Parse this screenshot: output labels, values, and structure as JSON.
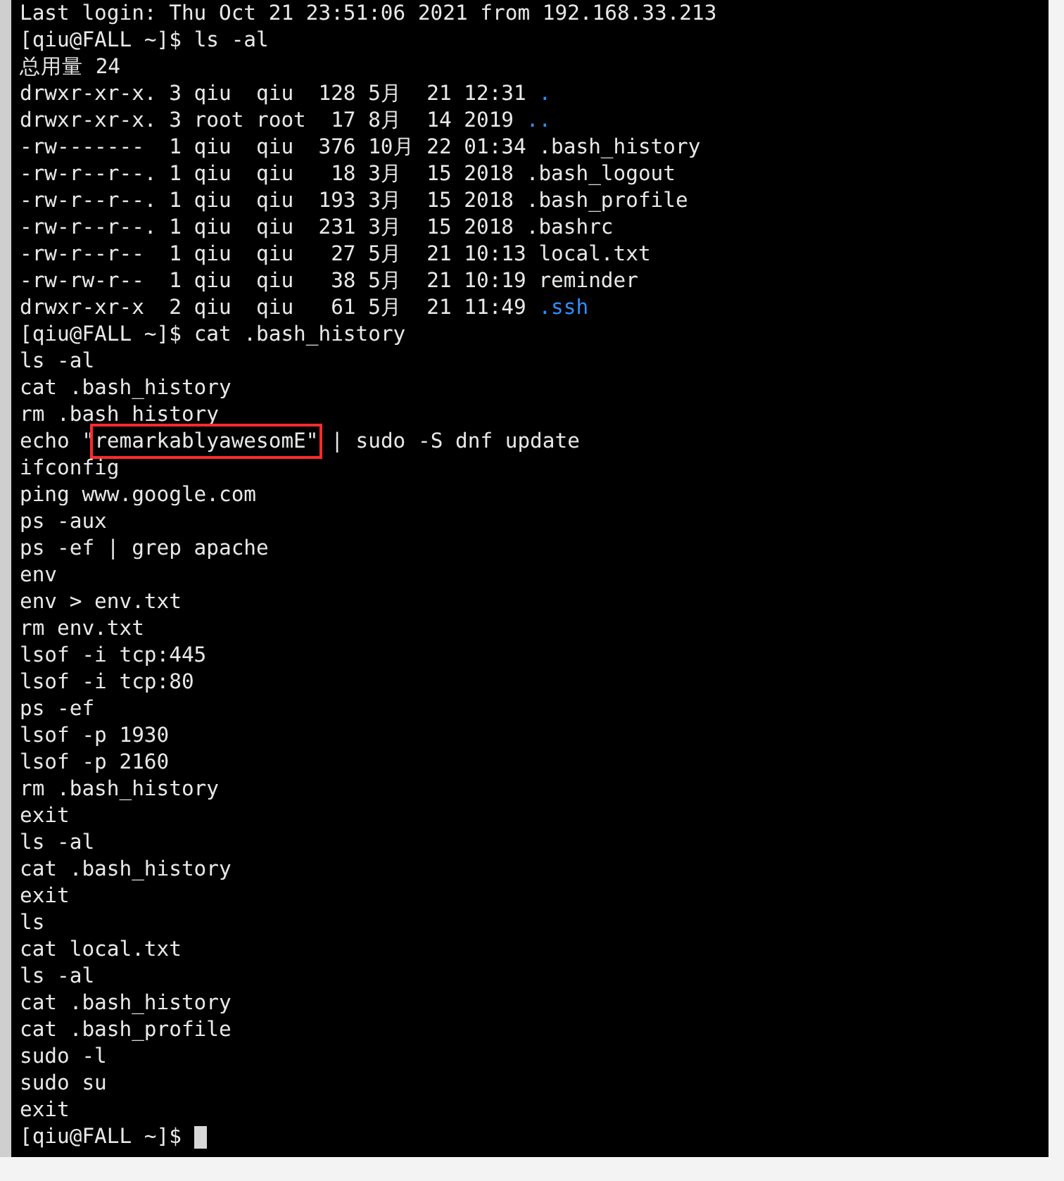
{
  "terminal": {
    "lines": [
      {
        "kind": "text",
        "text": "Last login: Thu Oct 21 23:51:06 2021 from 192.168.33.213"
      },
      {
        "kind": "prompt",
        "prompt": "[qiu@FALL ~]$",
        "command": "ls -al"
      },
      {
        "kind": "text",
        "text": "总用量 24"
      },
      {
        "kind": "listing",
        "info": "drwxr-xr-x. 3 qiu  qiu  128 5月  21 12:31",
        "name": ".",
        "color": "#2f8fff"
      },
      {
        "kind": "listing",
        "info": "drwxr-xr-x. 3 root root  17 8月  14 2019",
        "name": "..",
        "color": "#2f8fff"
      },
      {
        "kind": "listing",
        "info": "-rw-------  1 qiu  qiu  376 10月 22 01:34",
        "name": ".bash_history",
        "color": "#e8e8e8"
      },
      {
        "kind": "listing",
        "info": "-rw-r--r--. 1 qiu  qiu   18 3月  15 2018",
        "name": ".bash_logout",
        "color": "#e8e8e8"
      },
      {
        "kind": "listing",
        "info": "-rw-r--r--. 1 qiu  qiu  193 3月  15 2018",
        "name": ".bash_profile",
        "color": "#e8e8e8"
      },
      {
        "kind": "listing",
        "info": "-rw-r--r--. 1 qiu  qiu  231 3月  15 2018",
        "name": ".bashrc",
        "color": "#e8e8e8"
      },
      {
        "kind": "listing",
        "info": "-rw-r--r--  1 qiu  qiu   27 5月  21 10:13",
        "name": "local.txt",
        "color": "#e8e8e8"
      },
      {
        "kind": "listing",
        "info": "-rw-rw-r--  1 qiu  qiu   38 5月  21 10:19",
        "name": "reminder",
        "color": "#e8e8e8"
      },
      {
        "kind": "listing",
        "info": "drwxr-xr-x  2 qiu  qiu   61 5月  21 11:49",
        "name": ".ssh",
        "color": "#2f8fff"
      },
      {
        "kind": "prompt",
        "prompt": "[qiu@FALL ~]$",
        "command": "cat .bash_history"
      },
      {
        "kind": "text",
        "text": "ls -al"
      },
      {
        "kind": "text",
        "text": "cat .bash_history"
      },
      {
        "kind": "text",
        "text": "rm .bash_history"
      },
      {
        "kind": "highlighted",
        "before": "echo \"",
        "marked": "remarkablyawesomE\"",
        "after": " | sudo -S dnf update"
      },
      {
        "kind": "text",
        "text": "ifconfig"
      },
      {
        "kind": "text",
        "text": "ping www.google.com"
      },
      {
        "kind": "text",
        "text": "ps -aux"
      },
      {
        "kind": "text",
        "text": "ps -ef | grep apache"
      },
      {
        "kind": "text",
        "text": "env"
      },
      {
        "kind": "text",
        "text": "env > env.txt"
      },
      {
        "kind": "text",
        "text": "rm env.txt"
      },
      {
        "kind": "text",
        "text": "lsof -i tcp:445"
      },
      {
        "kind": "text",
        "text": "lsof -i tcp:80"
      },
      {
        "kind": "text",
        "text": "ps -ef"
      },
      {
        "kind": "text",
        "text": "lsof -p 1930"
      },
      {
        "kind": "text",
        "text": "lsof -p 2160"
      },
      {
        "kind": "text",
        "text": "rm .bash_history"
      },
      {
        "kind": "text",
        "text": "exit"
      },
      {
        "kind": "text",
        "text": "ls -al"
      },
      {
        "kind": "text",
        "text": "cat .bash_history"
      },
      {
        "kind": "text",
        "text": "exit"
      },
      {
        "kind": "text",
        "text": "ls"
      },
      {
        "kind": "text",
        "text": "cat local.txt"
      },
      {
        "kind": "text",
        "text": "ls -al"
      },
      {
        "kind": "text",
        "text": "cat .bash_history"
      },
      {
        "kind": "text",
        "text": "cat .bash_profile"
      },
      {
        "kind": "text",
        "text": "sudo -l"
      },
      {
        "kind": "text",
        "text": "sudo su"
      },
      {
        "kind": "text",
        "text": "exit"
      },
      {
        "kind": "cursor",
        "prompt": "[qiu@FALL ~]$"
      }
    ]
  }
}
